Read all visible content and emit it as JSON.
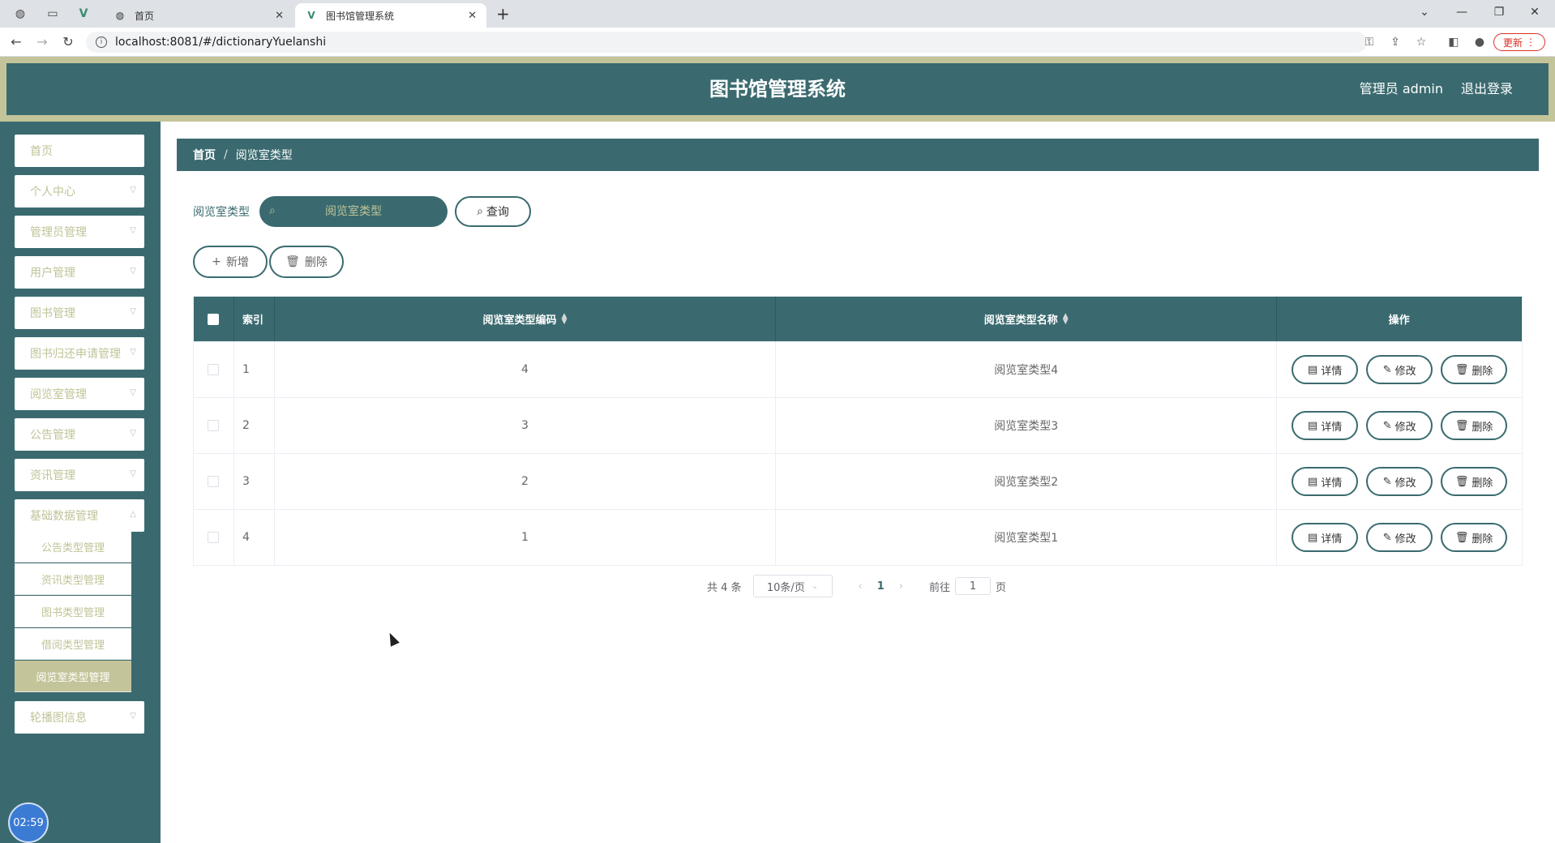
{
  "browser": {
    "tabs": [
      {
        "title": "首页",
        "active": false
      },
      {
        "title": "图书馆管理系统",
        "active": true
      }
    ],
    "url": "localhost:8081/#/dictionaryYuelanshi",
    "update_label": "更新"
  },
  "header": {
    "title": "图书馆管理系统",
    "user": "管理员 admin",
    "logout": "退出登录"
  },
  "sidebar": {
    "items": [
      {
        "label": "首页",
        "has_children": false
      },
      {
        "label": "个人中心",
        "has_children": true
      },
      {
        "label": "管理员管理",
        "has_children": true
      },
      {
        "label": "用户管理",
        "has_children": true
      },
      {
        "label": "图书管理",
        "has_children": true
      },
      {
        "label": "图书归还申请管理",
        "has_children": true
      },
      {
        "label": "阅览室管理",
        "has_children": true
      },
      {
        "label": "公告管理",
        "has_children": true
      },
      {
        "label": "资讯管理",
        "has_children": true
      },
      {
        "label": "基础数据管理",
        "has_children": true
      }
    ],
    "submenu": [
      {
        "label": "公告类型管理",
        "active": false
      },
      {
        "label": "资讯类型管理",
        "active": false
      },
      {
        "label": "图书类型管理",
        "active": false
      },
      {
        "label": "借阅类型管理",
        "active": false
      },
      {
        "label": "阅览室类型管理",
        "active": true
      }
    ],
    "last_item": {
      "label": "轮播图信息"
    },
    "clock": "02:59"
  },
  "breadcrumb": {
    "home": "首页",
    "separator": "/",
    "current": "阅览室类型"
  },
  "search": {
    "label": "阅览室类型",
    "placeholder": "阅览室类型",
    "query_label": "查询"
  },
  "actions": {
    "add_label": "新增",
    "delete_label": "删除"
  },
  "table": {
    "columns": {
      "index": "索引",
      "code": "阅览室类型编码",
      "name": "阅览室类型名称",
      "ops": "操作"
    },
    "rows": [
      {
        "index": "1",
        "code": "4",
        "name": "阅览室类型4"
      },
      {
        "index": "2",
        "code": "3",
        "name": "阅览室类型3"
      },
      {
        "index": "3",
        "code": "2",
        "name": "阅览室类型2"
      },
      {
        "index": "4",
        "code": "1",
        "name": "阅览室类型1"
      }
    ],
    "row_actions": {
      "detail": "详情",
      "edit": "修改",
      "delete": "删除"
    }
  },
  "pagination": {
    "total_text": "共 4 条",
    "page_size": "10条/页",
    "current_page": "1",
    "goto_prefix": "前往",
    "goto_value": "1",
    "goto_suffix": "页"
  },
  "colors": {
    "primary": "#3a6a6f",
    "accent": "#c4c49a",
    "menu_text": "#c0c397"
  }
}
